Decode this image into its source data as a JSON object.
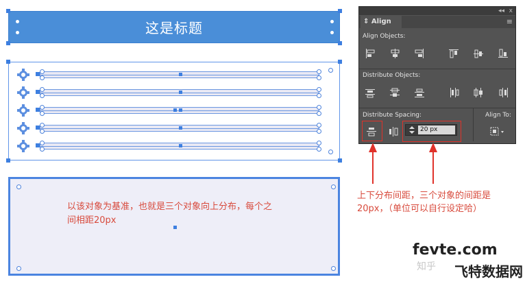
{
  "canvas": {
    "title_text": "这是标题",
    "left_note": "以该对象为基准，也就是三个对象向上分布，每个之间相距20px"
  },
  "panel": {
    "topbar_arrows": "◂◂",
    "topbar_close": "x",
    "tab_label": "Align",
    "tab_prefix": "⇕",
    "menu_icon": "≡",
    "align_objects_label": "Align Objects:",
    "distribute_objects_label": "Distribute Objects:",
    "distribute_spacing_label": "Distribute Spacing:",
    "align_to_label": "Align To:",
    "spacing_value": "20 px"
  },
  "annotation": {
    "right_note": "上下分布间距，三个对象的间距是20px，（单位可以自行设定哈）"
  },
  "watermark": {
    "site": "fevte.com",
    "brand": "飞特数据网",
    "source": "知乎"
  },
  "colors": {
    "title_bar": "#4a8ed8",
    "selection": "#3d7fe0",
    "panel_bg": "#535353",
    "annotation_red": "#d84a3c",
    "highlight_box": "#e0322a"
  },
  "icons": {
    "gear": "gear-icon",
    "arrow": "up-arrow-icon"
  }
}
